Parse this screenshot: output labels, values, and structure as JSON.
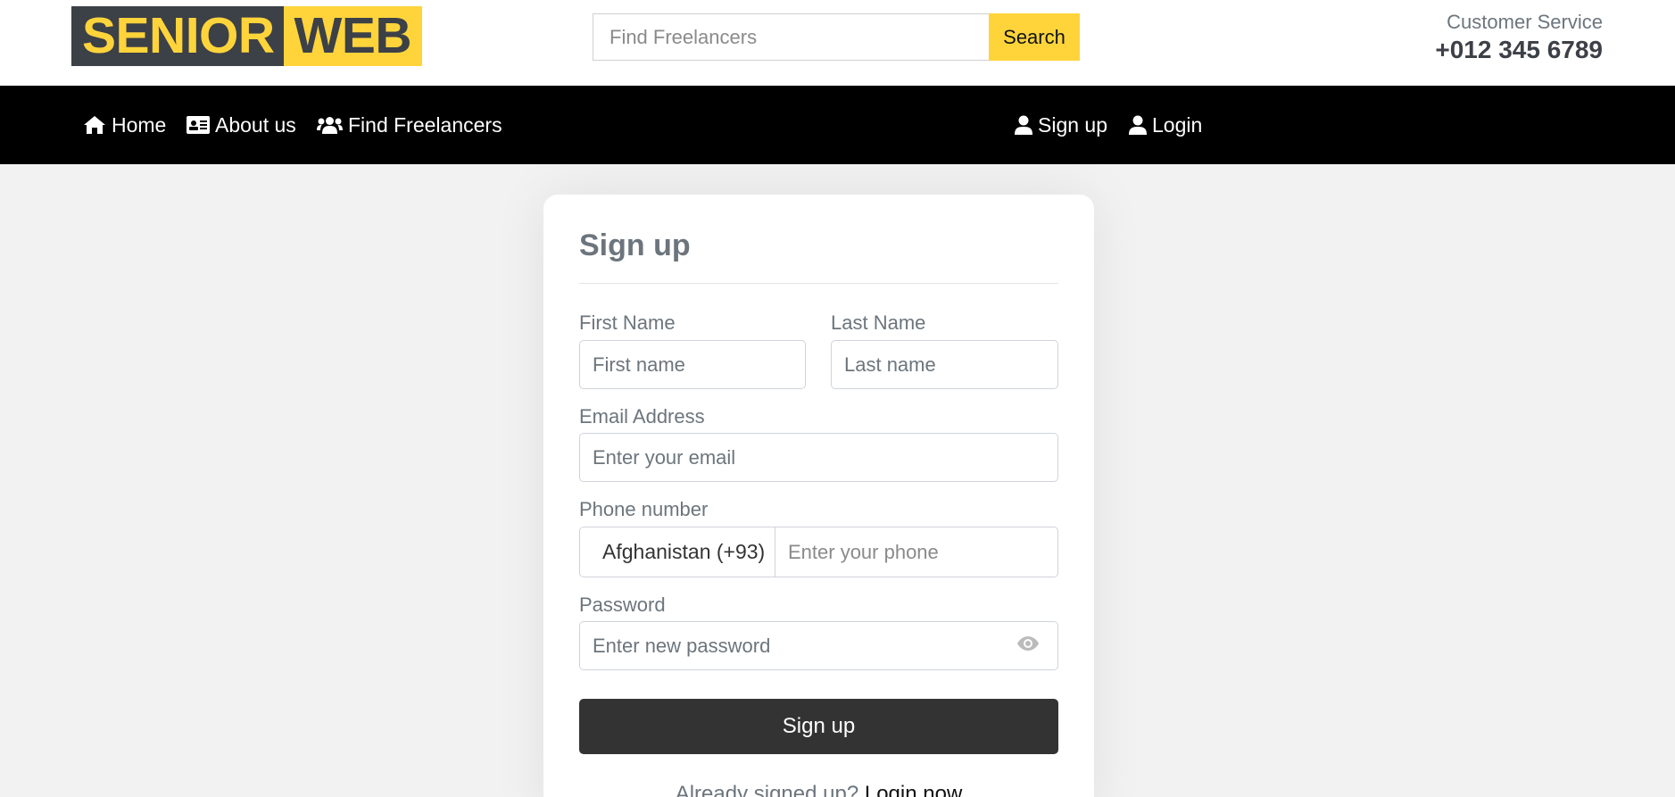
{
  "header": {
    "logo_part1": "SENIOR",
    "logo_part2": "WEB",
    "search_placeholder": "Find Freelancers",
    "search_button": "Search",
    "customer_service_label": "Customer Service",
    "customer_service_phone": "+012 345 6789"
  },
  "nav": {
    "left": [
      {
        "label": "Home",
        "icon": "home-icon"
      },
      {
        "label": "About us",
        "icon": "id-card-icon"
      },
      {
        "label": "Find Freelancers",
        "icon": "users-icon"
      }
    ],
    "right": [
      {
        "label": "Sign up",
        "icon": "user-icon"
      },
      {
        "label": "Login",
        "icon": "user-icon"
      }
    ]
  },
  "form": {
    "title": "Sign up",
    "first_name_label": "First Name",
    "first_name_placeholder": "First name",
    "last_name_label": "Last Name",
    "last_name_placeholder": "Last name",
    "email_label": "Email Address",
    "email_placeholder": "Enter your email",
    "phone_label": "Phone number",
    "country_value": "Afghanistan (+93)",
    "phone_placeholder": "Enter your phone",
    "password_label": "Password",
    "password_placeholder": "Enter new password",
    "submit_label": "Sign up",
    "already_text": "Already signed up?",
    "login_link": "Login now"
  },
  "colors": {
    "accent": "#ffd43b",
    "logo_dark": "#3c4047",
    "nav_bg": "#000000",
    "button_dark": "#333333"
  }
}
